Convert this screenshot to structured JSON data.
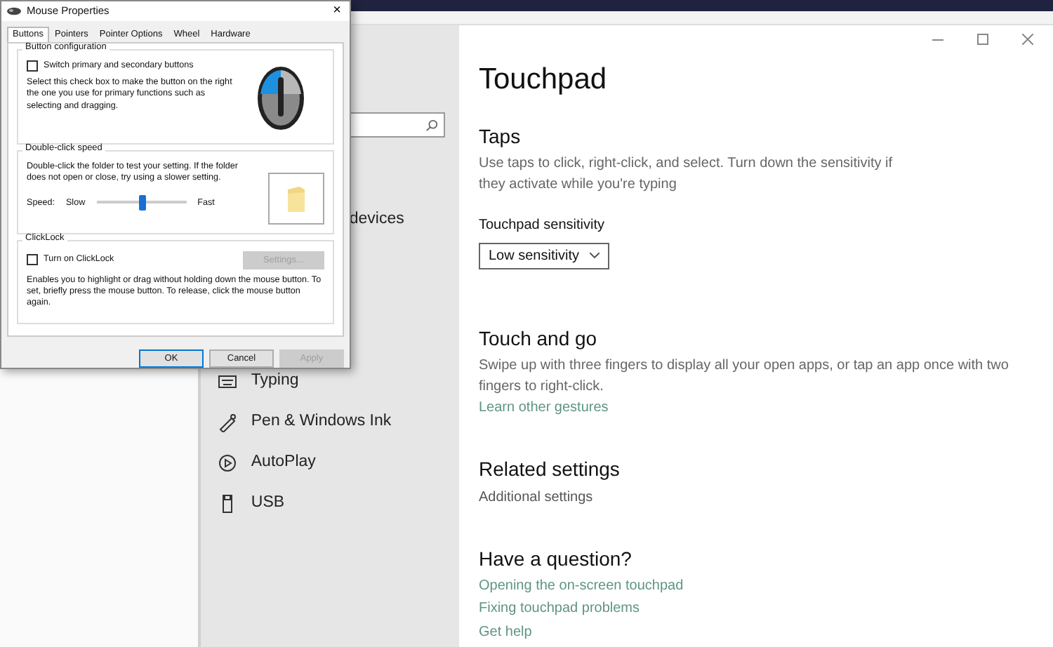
{
  "dialog": {
    "title": "Mouse Properties",
    "close": "×",
    "tabs": [
      {
        "label": "Buttons",
        "selected": true
      },
      {
        "label": "Pointers",
        "selected": false
      },
      {
        "label": "Pointer Options",
        "selected": false
      },
      {
        "label": "Wheel",
        "selected": false
      },
      {
        "label": "Hardware",
        "selected": false
      }
    ],
    "button_configuration": {
      "legend": "Button configuration",
      "checkbox": {
        "label": "Switch primary and secondary buttons",
        "checked": false
      },
      "description": "Select this check box to make the button on the right the one you use for primary functions such as selecting and dragging."
    },
    "double_click_speed": {
      "legend": "Double-click speed",
      "description": "Double-click the folder to test your setting. If the folder does not open or close, try using a slower setting.",
      "speed_label": "Speed:",
      "slow": "Slow",
      "fast": "Fast",
      "slider": {
        "level": 0.5
      }
    },
    "clicklock": {
      "legend": "ClickLock",
      "checkbox": {
        "label": "Turn on ClickLock",
        "checked": false
      },
      "settings_button": {
        "label": "Settings...",
        "disabled": true
      },
      "description": "Enables you to highlight or drag without holding down the mouse button. To set, briefly press the mouse button. To release, click the mouse button again."
    },
    "buttons": [
      {
        "label": "OK",
        "disabled": false,
        "default": true
      },
      {
        "label": "Cancel",
        "disabled": false,
        "default": false
      },
      {
        "label": "Apply",
        "disabled": true,
        "default": false
      }
    ]
  },
  "settings": {
    "sidebar": {
      "items": [
        {
          "kind": "cut",
          "label": "devices"
        },
        {
          "kind": "keyboard",
          "label": "Typing"
        },
        {
          "kind": "pen",
          "label": "Pen & Windows Ink"
        },
        {
          "kind": "autoplay",
          "label": "AutoPlay"
        },
        {
          "kind": "usb",
          "label": "USB"
        }
      ]
    },
    "page": {
      "title": "Touchpad",
      "sections": [
        {
          "heading": "Taps",
          "description": "Use taps to click, right-click, and select. Turn down the sensitivity if they activate while you're typing",
          "field_label": "Touchpad sensitivity",
          "dropdown": "Low sensitivity"
        },
        {
          "heading": "Touch and go",
          "description": "Swipe up with three fingers to display all your open apps, or tap an app once with two fingers to right-click.",
          "links": [
            "Learn other gestures"
          ]
        },
        {
          "heading": "Related settings",
          "plain_links": [
            "Additional settings"
          ]
        },
        {
          "heading": "Have a question?",
          "links": [
            "Opening the on-screen touchpad",
            "Fixing touchpad problems",
            "Get help"
          ]
        }
      ]
    }
  }
}
